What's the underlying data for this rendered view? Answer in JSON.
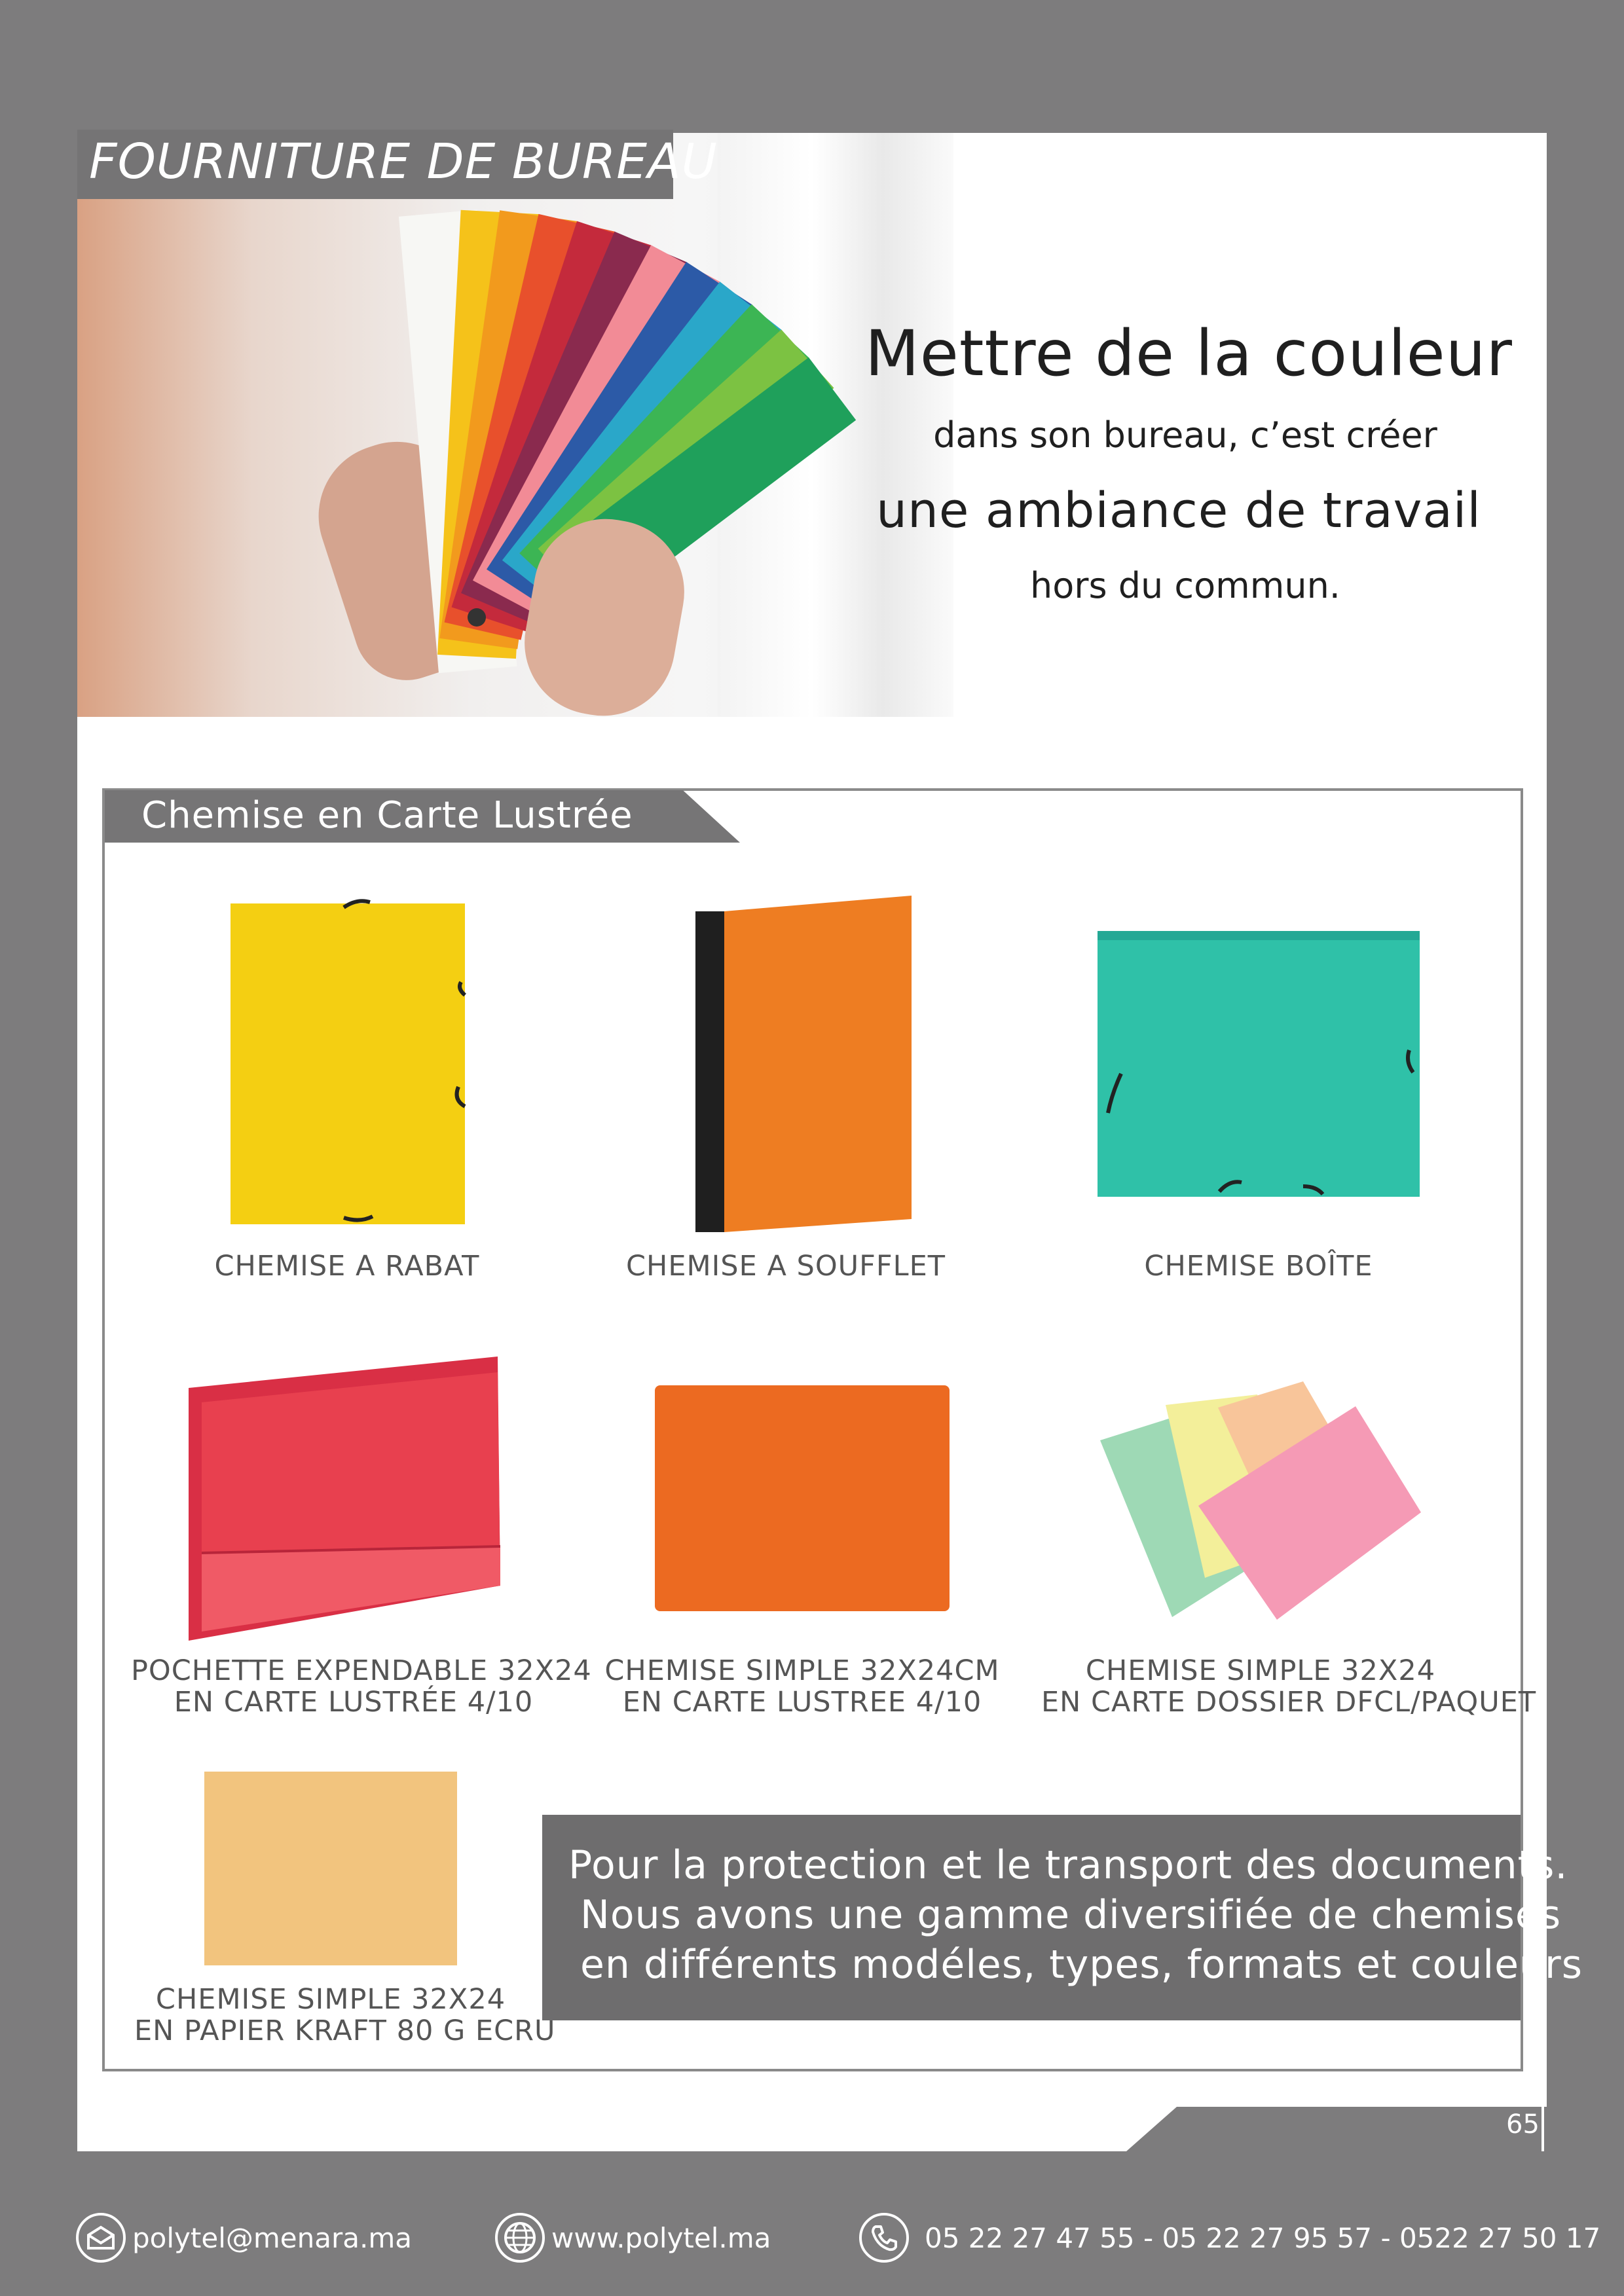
{
  "header": {
    "title": "FOURNITURE DE BUREAU"
  },
  "tagline": {
    "line1": "Mettre de la couleur",
    "line2": "dans son bureau, c’est créer",
    "line3": "une ambiance de travail",
    "line4": "hors du commun."
  },
  "section": {
    "title": "Chemise en Carte Lustrée"
  },
  "products": [
    {
      "line1": "CHEMISE A RABAT",
      "line2": "",
      "color": "#f4cf12"
    },
    {
      "line1": "CHEMISE A SOUFFLET",
      "line2": "",
      "color": "#ee7d22"
    },
    {
      "line1": "CHEMISE BOÎTE",
      "line2": "",
      "color": "#2fc1a8"
    },
    {
      "line1": "POCHETTE EXPENDABLE 32X24",
      "line2": "EN CARTE LUSTRÉE 4/10",
      "color": "#e8404f"
    },
    {
      "line1": "CHEMISE SIMPLE 32X24CM",
      "line2": "EN CARTE LUSTREE 4/10",
      "color": "#ec6a21"
    },
    {
      "line1": "CHEMISE SIMPLE 32X24",
      "line2": "EN CARTE DOSSIER DFCL/PAQUET",
      "color": "#f59ab5"
    },
    {
      "line1": "CHEMISE SIMPLE 32X24",
      "line2": "EN PAPIER KRAFT 80 G ECRU",
      "color": "#f2c47e"
    }
  ],
  "info": {
    "line1": "Pour la protection et le transport des documents.",
    "line2": "Nous avons une gamme diversifiée de chemises",
    "line3": "en différents modéles, types, formats et couleurs"
  },
  "page_number": "65",
  "footer": {
    "email": "polytel@menara.ma",
    "website": "www.polytel.ma",
    "phones": "05 22 27 47 55 - 05 22 27 95 57 - 0522 27 50 17",
    "icons": [
      "mail-icon",
      "globe-icon",
      "phone-icon"
    ]
  }
}
